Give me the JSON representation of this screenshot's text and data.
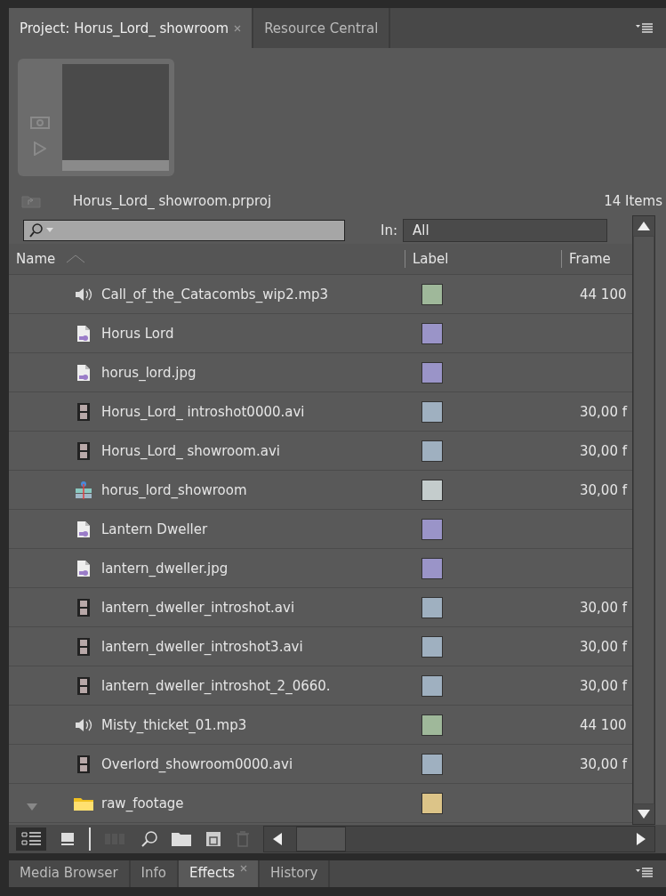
{
  "tabs": [
    {
      "label": "Project: Horus_Lord_ showroom",
      "selected": true,
      "closable": true
    },
    {
      "label": "Resource Central",
      "selected": false,
      "closable": false
    }
  ],
  "project": {
    "file": "Horus_Lord_ showroom.prproj",
    "count": "14 Items"
  },
  "search": {
    "in_label": "In:",
    "in_value": "All"
  },
  "columns": [
    "Name",
    "Label",
    "Frame"
  ],
  "rows": [
    {
      "kind": "audio",
      "name": "Call_of_the_Catacombs_wip2.mp3",
      "color": "#9fb89a",
      "rate": "44 100"
    },
    {
      "kind": "still",
      "name": "Horus Lord",
      "color": "#9a94c8",
      "rate": ""
    },
    {
      "kind": "still",
      "name": "horus_lord.jpg",
      "color": "#9a94c8",
      "rate": ""
    },
    {
      "kind": "video",
      "name": "Horus_Lord_ introshot0000.avi",
      "color": "#9fb0c0",
      "rate": "30,00 f"
    },
    {
      "kind": "video",
      "name": "Horus_Lord_ showroom.avi",
      "color": "#9fb0c0",
      "rate": "30,00 f"
    },
    {
      "kind": "sequence",
      "name": "horus_lord_showroom",
      "color": "#c4cccc",
      "rate": "30,00 f"
    },
    {
      "kind": "still",
      "name": "Lantern Dweller",
      "color": "#9a94c8",
      "rate": ""
    },
    {
      "kind": "still",
      "name": "lantern_dweller.jpg",
      "color": "#9a94c8",
      "rate": ""
    },
    {
      "kind": "video",
      "name": "lantern_dweller_introshot.avi",
      "color": "#9fb0c0",
      "rate": "30,00 f"
    },
    {
      "kind": "video",
      "name": "lantern_dweller_introshot3.avi",
      "color": "#9fb0c0",
      "rate": "30,00 f"
    },
    {
      "kind": "video",
      "name": "lantern_dweller_introshot_2_0660.",
      "color": "#9fb0c0",
      "rate": "30,00 f"
    },
    {
      "kind": "audio",
      "name": "Misty_thicket_01.mp3",
      "color": "#9fb89a",
      "rate": "44 100"
    },
    {
      "kind": "video",
      "name": "Overlord_showroom0000.avi",
      "color": "#9fb0c0",
      "rate": "30,00 f"
    },
    {
      "kind": "folder",
      "name": "raw_footage",
      "color": "#dcc488",
      "rate": ""
    }
  ],
  "bottom_tabs": [
    {
      "label": "Media Browser",
      "selected": false,
      "closable": false
    },
    {
      "label": "Info",
      "selected": false,
      "closable": false
    },
    {
      "label": "Effects",
      "selected": true,
      "closable": true
    },
    {
      "label": "History",
      "selected": false,
      "closable": false
    }
  ]
}
